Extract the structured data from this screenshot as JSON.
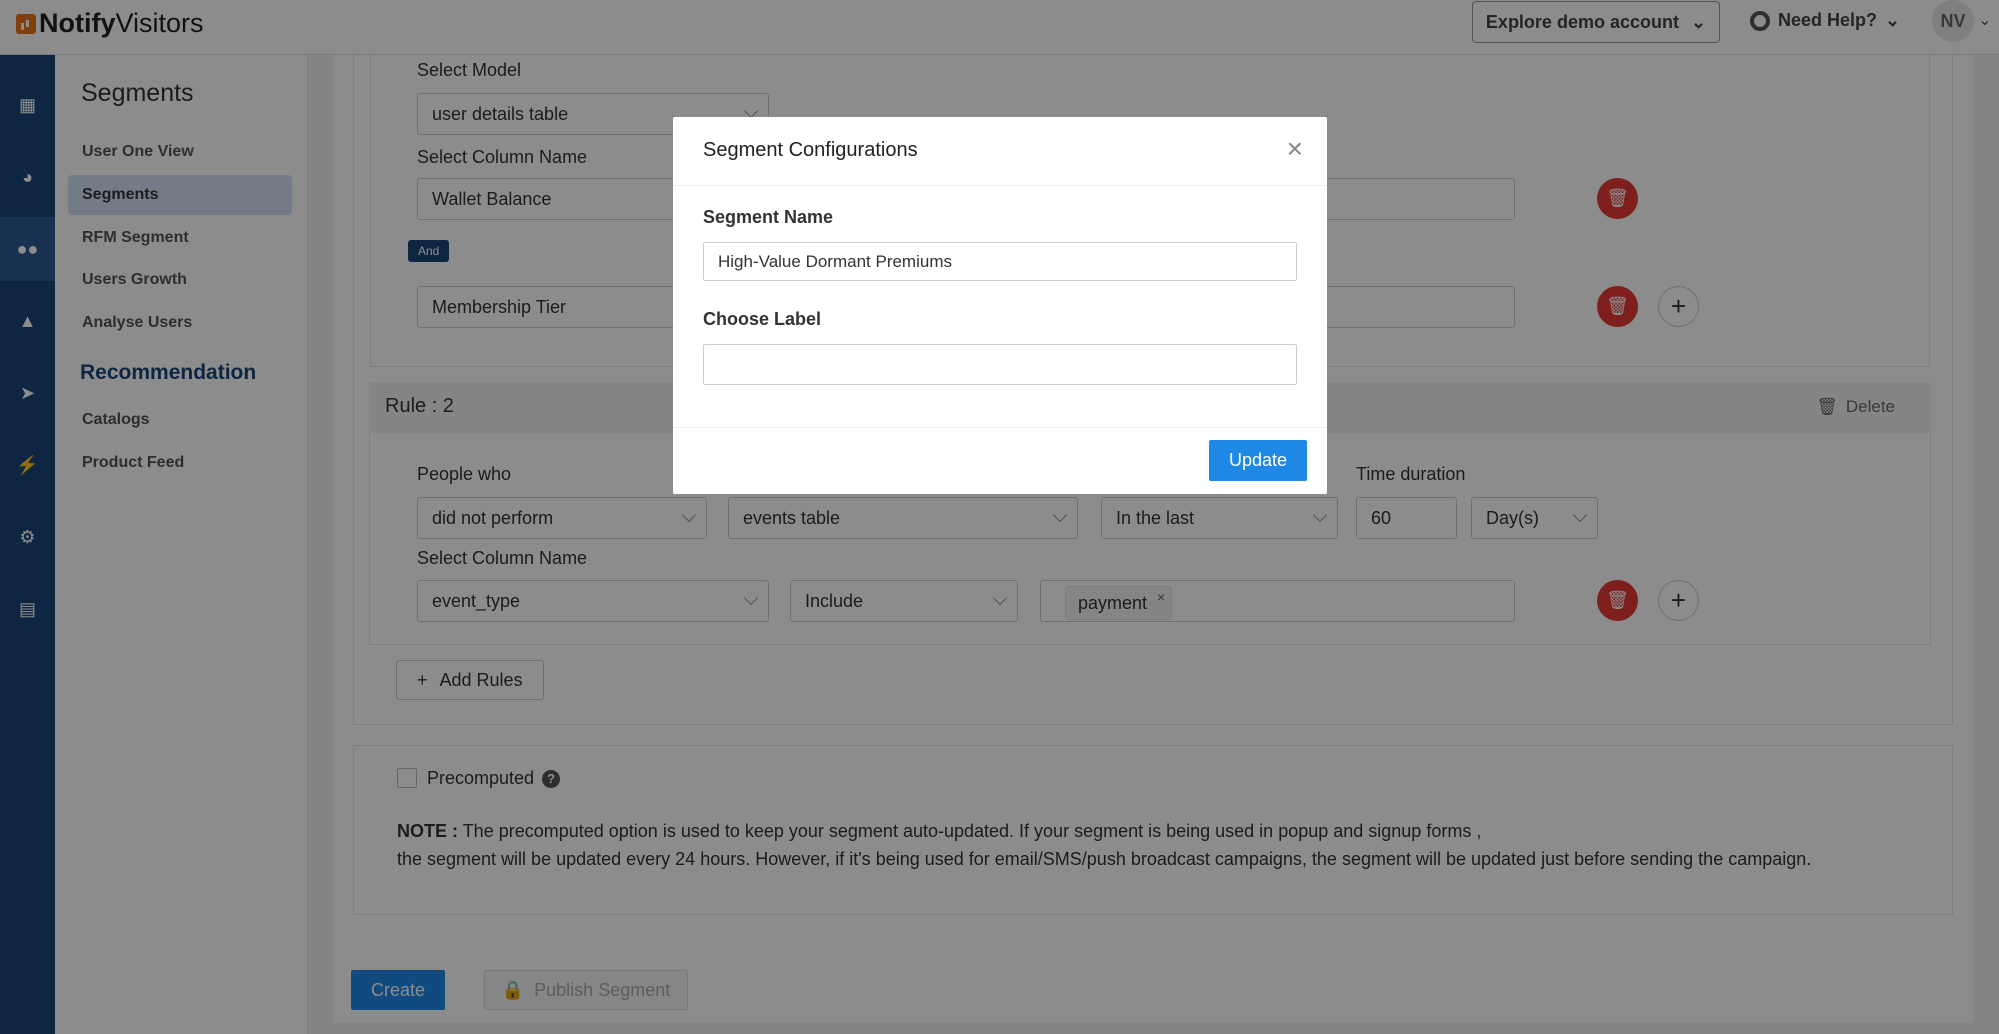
{
  "topbar": {
    "logo_bold": "Notify",
    "logo_rest": "Visitors",
    "explore_label": "Explore demo account",
    "help_label": "Need Help?",
    "avatar_initials": "NV"
  },
  "rail": {
    "icons": [
      "grid-icon",
      "dashboard-icon",
      "users-icon",
      "sitemap-icon",
      "send-icon",
      "bolt-icon",
      "gear-icon",
      "building-icon"
    ]
  },
  "sidebar": {
    "title": "Segments",
    "items": [
      {
        "label": "User One View"
      },
      {
        "label": "Segments"
      },
      {
        "label": "RFM Segment"
      },
      {
        "label": "Users Growth"
      },
      {
        "label": "Analyse Users"
      }
    ],
    "section2_title": "Recommendation",
    "section2_items": [
      {
        "label": "Catalogs"
      },
      {
        "label": "Product Feed"
      }
    ]
  },
  "rule1": {
    "select_model_label": "Select Model",
    "select_model_value": "user details table",
    "select_column_label": "Select Column Name",
    "column1_value": "Wallet Balance",
    "and_label": "And",
    "column2_value": "Membership Tier"
  },
  "rule2": {
    "title": "Rule : 2",
    "delete_label": "Delete",
    "people_who_label": "People who",
    "people_who_value": "did not perform",
    "events_value": "events table",
    "time_value": "In the last",
    "time_duration_label": "Time duration",
    "duration_value": "60",
    "duration_unit": "Day(s)",
    "select_column_label": "Select Column Name",
    "column_value": "event_type",
    "operator_value": "Include",
    "tag_value": "payment"
  },
  "add_rules_label": "Add Rules",
  "precomputed": {
    "label": "Precomputed",
    "note_bold": "NOTE :",
    "note_line1": "The precomputed option is used to keep your segment auto-updated. If your segment is being used in popup and signup forms ,",
    "note_line2": "the segment will be updated every 24 hours. However, if it's being used for email/SMS/push broadcast campaigns, the segment will be updated just before sending the campaign."
  },
  "footer": {
    "create_label": "Create",
    "publish_label": "Publish Segment"
  },
  "modal": {
    "title": "Segment Configurations",
    "segment_name_label": "Segment Name",
    "segment_name_value": "High-Value Dormant Premiums",
    "choose_label_label": "Choose Label",
    "choose_label_value": "",
    "update_label": "Update"
  },
  "colors": {
    "brand_dark": "#1b4679",
    "primary": "#1e88e5",
    "danger": "#e53935"
  }
}
